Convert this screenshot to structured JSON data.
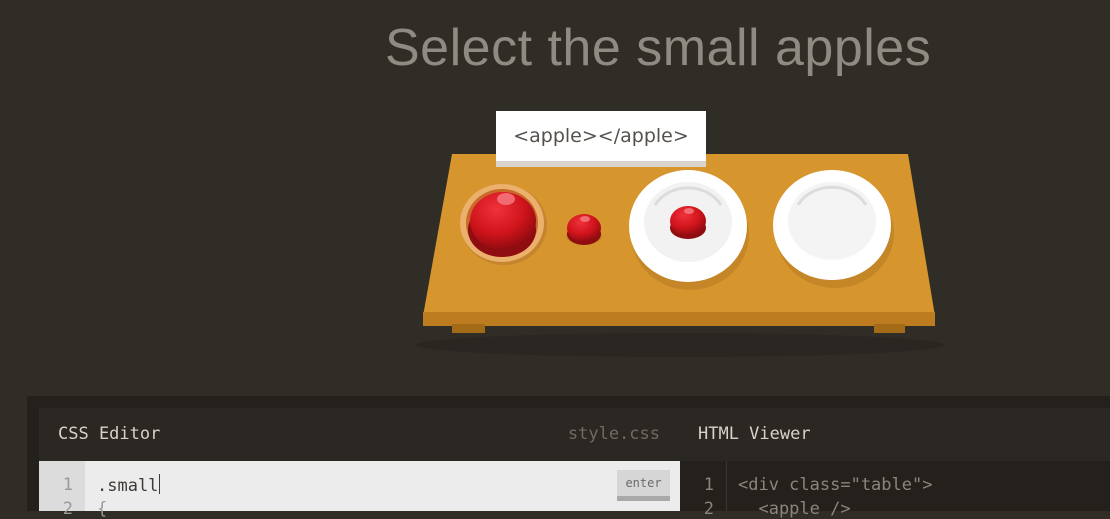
{
  "level": {
    "instruction": "Select the small apples",
    "hover_tooltip": "<apple></apple>"
  },
  "table": {
    "items": [
      {
        "name": "apple",
        "size": "large",
        "on": "bento"
      },
      {
        "name": "apple",
        "size": "small",
        "on": "table"
      },
      {
        "name": "apple",
        "size": "small",
        "on": "plate"
      },
      {
        "name": "plate",
        "size": "empty",
        "on": "table"
      }
    ]
  },
  "css_editor": {
    "title": "CSS Editor",
    "filename": "style.css",
    "line_numbers": [
      "1",
      "2"
    ],
    "input_value": ".small",
    "line2": "{",
    "enter_label": "enter"
  },
  "html_viewer": {
    "title": "HTML Viewer",
    "line_numbers": [
      "1",
      "2"
    ],
    "lines": [
      "<div class=\"table\">",
      "  <apple />"
    ]
  },
  "colors": {
    "background": "#302c26",
    "table": "#d4922b",
    "apple": "#c8141a",
    "plate": "#ffffff",
    "bento": "#e8a35a"
  }
}
